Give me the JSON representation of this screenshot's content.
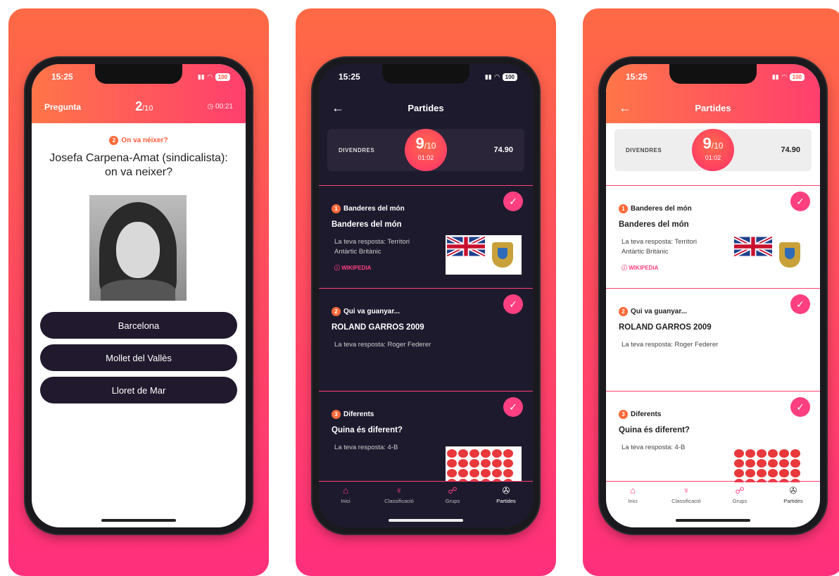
{
  "screen1": {
    "status": {
      "time": "15:25",
      "battery": "100"
    },
    "header": {
      "label": "Pregunta",
      "number": "2",
      "of": "/10",
      "timer": "00:21"
    },
    "category": {
      "badge": "2",
      "text": "On va néixer?"
    },
    "question": "Josefa Carpena-Amat (sindicalista): on va neixer?",
    "answers": [
      "Barcelona",
      "Mollet del Vallès",
      "Lloret de Mar"
    ]
  },
  "screen2": {
    "status": {
      "time": "15:25",
      "battery": "100"
    },
    "title": "Partides",
    "score": {
      "day": "DIVENDRES",
      "value": "9",
      "of": "/10",
      "time": "01:02",
      "points": "74.90"
    },
    "items": [
      {
        "num": "1",
        "category": "Banderes del món",
        "heading": "Banderes del món",
        "response": "La teva resposta: Territori Antàrtic Britànic",
        "link": "WIKIPEDIA",
        "check": "✓"
      },
      {
        "num": "2",
        "category": "Qui va guanyar...",
        "heading": "ROLAND GARROS 2009",
        "response": "La teva resposta: Roger Federer",
        "check": "✓"
      },
      {
        "num": "3",
        "category": "Diferents",
        "heading": "Quina és diferent?",
        "response": "La teva resposta: 4-B",
        "check": "✓"
      }
    ],
    "tabs": [
      {
        "label": "Inici",
        "icon": "home-icon",
        "glyph": "⌂"
      },
      {
        "label": "Classificació",
        "icon": "trophy-icon",
        "glyph": "♆"
      },
      {
        "label": "Grups",
        "icon": "group-icon",
        "glyph": "☍"
      },
      {
        "label": "Partides",
        "icon": "gamepad-icon",
        "glyph": "✇"
      }
    ]
  },
  "screen3": {
    "status": {
      "time": "15:25",
      "battery": "100"
    },
    "title": "Partides",
    "score": {
      "day": "DIVENDRES",
      "value": "9",
      "of": "/10",
      "time": "01:02",
      "points": "74.90"
    },
    "items": [
      {
        "num": "1",
        "category": "Banderes del món",
        "heading": "Banderes del món",
        "response": "La teva resposta: Territori Antàrtic Britànic",
        "link": "WIKIPEDIA",
        "check": "✓"
      },
      {
        "num": "2",
        "category": "Qui va guanyar...",
        "heading": "ROLAND GARROS 2009",
        "response": "La teva resposta: Roger Federer",
        "check": "✓"
      },
      {
        "num": "3",
        "category": "Diferents",
        "heading": "Quina és diferent?",
        "response": "La teva resposta: 4-B",
        "check": "✓"
      }
    ],
    "tabs": [
      {
        "label": "Inici",
        "icon": "home-icon",
        "glyph": "⌂"
      },
      {
        "label": "Classificació",
        "icon": "trophy-icon",
        "glyph": "♆"
      },
      {
        "label": "Grups",
        "icon": "group-icon",
        "glyph": "☍"
      },
      {
        "label": "Partides",
        "icon": "gamepad-icon",
        "glyph": "✇"
      }
    ]
  },
  "colors": {
    "accent": "#ff3f80",
    "orange": "#ff6a45",
    "dark_bg": "#1e1a2e",
    "answer_bg": "#211a2e"
  }
}
